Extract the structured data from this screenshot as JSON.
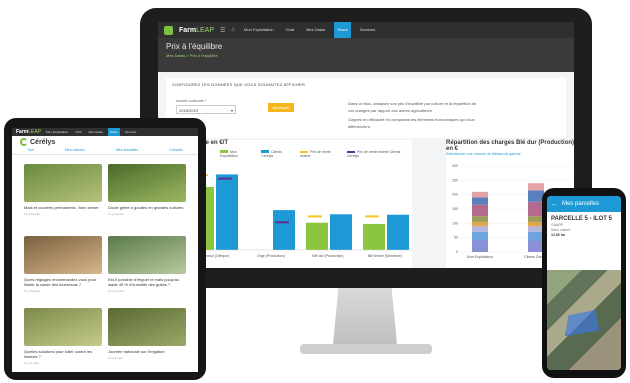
{
  "desktop": {
    "brand": {
      "name": "Farm",
      "suffix": "LEAP"
    },
    "nav": [
      "Mon Exploitation",
      "Chat",
      "Mes Datas",
      "Share",
      "Services"
    ],
    "active_nav_index": 3,
    "page_title": "Prix à l'équilibre",
    "breadcrumb": "Mes Datas > Prix à l'équilibre",
    "section_title": "CONFIGUREZ LES DONNÉES QUE VOUS SOUHAITEZ AFFICHER",
    "field_label": "Année culturale *",
    "field_value": "2018/2019",
    "apply_label": "Appliquer",
    "description_1": "Dans ce bloc, analysez vos prix d'équilibre par culture et la répartition de vos charges par rapport aux autres agriculteurs.",
    "description_2": "Gagnez en efficacité en comparant les éléments économiques qui vous différencient.",
    "chart_title": "équilibre en €/T",
    "stack_title": "Répartition des charges Blé dur (Production) en €",
    "stack_subtitle": "Sélectionnez une colonne de tableau de gauche"
  },
  "chart_data": [
    {
      "type": "bar",
      "title": "équilibre en €/T",
      "categories": [
        "Tournesol (Oléique)",
        "Orge (Production)",
        "Blé dur (Production)",
        "Blé tendre (Semence)"
      ],
      "series": [
        {
          "name": "Mon Exploitation",
          "color": "#8cc63f",
          "values": [
            150,
            0,
            65,
            62
          ]
        },
        {
          "name": "Clients Cerelys",
          "color": "#1d9ad6",
          "values": [
            180,
            95,
            85,
            84
          ]
        }
      ],
      "markers": [
        {
          "name": "Prix de vente estimé",
          "color": "#f3c623",
          "values": [
            178,
            0,
            80,
            80
          ]
        },
        {
          "name": "Prix de vente estimé Clients Cerelys",
          "color": "#6a2c91",
          "values": [
            170,
            66,
            0,
            0
          ]
        }
      ],
      "ylim": [
        0,
        200
      ]
    },
    {
      "type": "bar",
      "title": "Répartition des charges Blé dur (Production) en €",
      "categories": [
        "Mon Exploitation",
        "Clients Cerelys"
      ],
      "yticks": [
        0,
        50,
        100,
        150,
        200,
        250,
        300
      ],
      "ylim": [
        0,
        300
      ],
      "series": [
        {
          "color": "#8b8fd6",
          "values": [
            40,
            40
          ]
        },
        {
          "color": "#6fa3e0",
          "values": [
            30,
            30
          ]
        },
        {
          "color": "#b5b4dd",
          "values": [
            20,
            20
          ]
        },
        {
          "color": "#e2a64a",
          "values": [
            15,
            15
          ]
        },
        {
          "color": "#9c9c5a",
          "values": [
            20,
            20
          ]
        },
        {
          "color": "#b46a8e",
          "values": [
            40,
            50
          ]
        },
        {
          "color": "#5a7fbd",
          "values": [
            25,
            40
          ]
        },
        {
          "color": "#e6a3a7",
          "values": [
            20,
            25
          ]
        }
      ]
    }
  ],
  "tablet": {
    "brand": {
      "name": "Farm",
      "suffix": "LEAP"
    },
    "nav": [
      "Mon Exploitation",
      "Chat",
      "Mes Datas",
      "Share",
      "Services"
    ],
    "logo": "Cérélys",
    "tabs": [
      "Tout",
      "Mes cultures",
      "Mes actualités",
      "Conseils"
    ],
    "cards": [
      {
        "text": "Maïs et couverts permanents : bien semer",
        "meta": "il y a 2 jours",
        "colors": [
          "#6a8a3a",
          "#b4c27a"
        ]
      },
      {
        "text": "Doute gelée à gouttes en grandes cultures",
        "meta": "il y a 3 jours",
        "colors": [
          "#4c6a2a",
          "#9ab860"
        ]
      },
      {
        "text": "Quels réglages recommandez-vous pour limiter la casse des tournesols ?",
        "meta": "il y a 5 jours",
        "colors": [
          "#7a6040",
          "#d7b78a"
        ]
      },
      {
        "text": "Est-il possible d'irriguer le maïs jusqu'au stade 45 % d'humidité des grains ?",
        "meta": "il y a 6 jours",
        "colors": [
          "#5a7a4a",
          "#b9c9a0"
        ]
      },
      {
        "text": "Quelles solutions pour lutter contre les limaces ?",
        "meta": "il y a 1 sem.",
        "colors": [
          "#7a8a4a",
          "#c6cb8a"
        ]
      },
      {
        "text": "Journée nationale sur l'irrigation",
        "meta": "il y a 1 sem.",
        "colors": [
          "#5a6a32",
          "#9aa868"
        ]
      }
    ]
  },
  "phone": {
    "title": "Mes parcelles",
    "parcel": "PARCELLE 5 - ILOT 5",
    "line_1": "GAARP",
    "line_2": "Sans culture",
    "line_3": "12,50 ha"
  }
}
